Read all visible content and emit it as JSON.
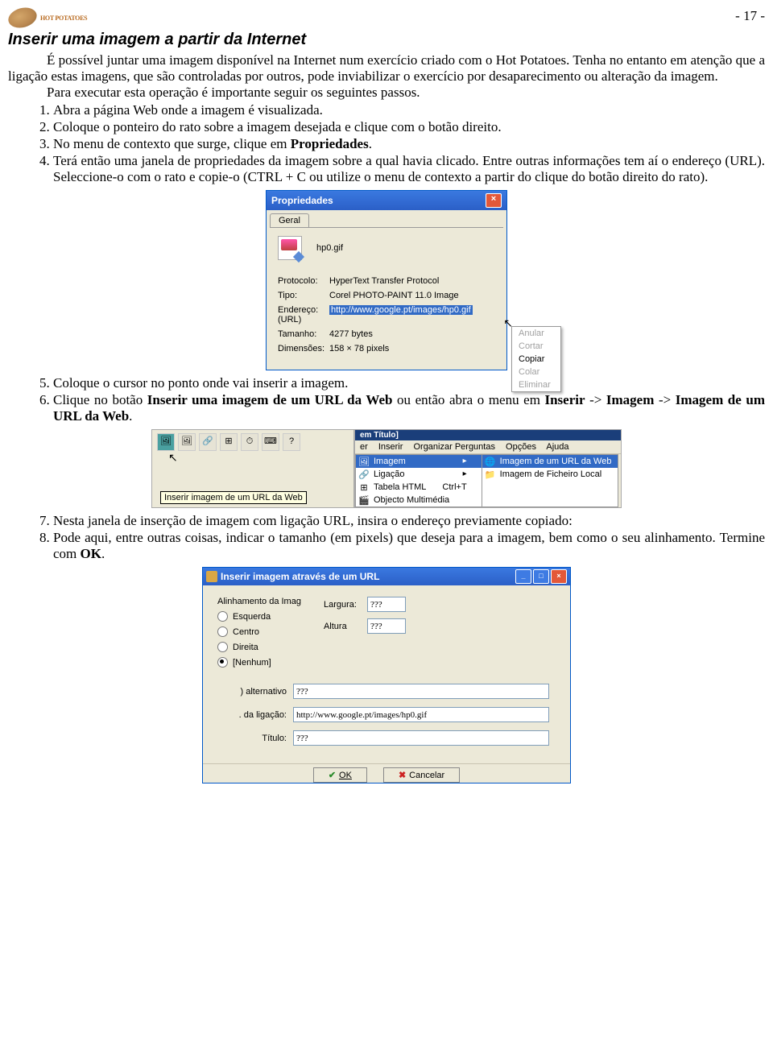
{
  "header": {
    "logo_text": "HOT POTATOES",
    "page_number": "- 17 -"
  },
  "title": "Inserir uma imagem a partir da Internet",
  "para1": "É possível juntar uma imagem disponível na Internet num exercício criado com o Hot Potatoes. Tenha no entanto em atenção que a ligação estas imagens, que são controladas por outros, pode inviabilizar o exercício por desaparecimento ou alteração da imagem.",
  "para2": "Para executar esta operação é importante seguir os seguintes passos.",
  "list1": {
    "s1": "Abra a página Web onde a imagem é visualizada.",
    "s2": "Coloque o ponteiro do rato sobre a imagem desejada e clique com o botão direito.",
    "s3a": "No menu de contexto que surge, clique em ",
    "s3b": "Propriedades",
    "s3c": ".",
    "s4": "Terá então uma janela de propriedades da imagem sobre a qual havia clicado. Entre outras informações tem aí o endereço (URL). Seleccione-o com o rato e copie-o (CTRL + C ou utilize o menu de contexto a partir do clique do botão direito do rato)."
  },
  "propdlg": {
    "title": "Propriedades",
    "tab": "Geral",
    "filename": "hp0.gif",
    "rows": {
      "proto_l": "Protocolo:",
      "proto_v": "HyperText Transfer Protocol",
      "tipo_l": "Tipo:",
      "tipo_v": "Corel PHOTO-PAINT 11.0 Image",
      "url_l": "Endereço:\n(URL)",
      "url_v": "http://www.google.pt/images/hp0.gif",
      "tam_l": "Tamanho:",
      "tam_v": "4277 bytes",
      "dim_l": "Dimensões:",
      "dim_v": "158 × 78 pixels"
    },
    "ctx": {
      "anular": "Anular",
      "cortar": "Cortar",
      "copiar": "Copiar",
      "colar": "Colar",
      "eliminar": "Eliminar"
    }
  },
  "list2": {
    "s5": "Coloque o cursor no ponto onde vai inserir a imagem.",
    "s6a": "Clique no botão ",
    "s6b": "Inserir uma imagem de um URL da Web",
    "s6c": " ou então abra o menu em ",
    "s6d": "Inserir",
    "s6e": " -> ",
    "s6f": "Imagem",
    "s6g": " -> ",
    "s6h": "Imagem de um URL da Web",
    "s6i": "."
  },
  "menu": {
    "titlestrip": "em Título]",
    "tooltip": "Inserir imagem de um URL da Web",
    "menubar": {
      "er": "er",
      "inserir": "Inserir",
      "organizar": "Organizar Perguntas",
      "opcoes": "Opções",
      "ajuda": "Ajuda"
    },
    "sub": {
      "imagem": "Imagem",
      "ligacao": "Ligação",
      "tabela": "Tabela HTML",
      "tabela_s": "Ctrl+T",
      "obj": "Objecto Multimédia"
    },
    "sub2": {
      "url": "Imagem de um URL da Web",
      "file": "Imagem de Ficheiro Local"
    }
  },
  "list3": {
    "s7": "Nesta janela de inserção de imagem com ligação URL, insira o endereço previamente copiado:",
    "s8a": "Pode aqui, entre outras coisas, indicar o tamanho (em pixels) que deseja para a imagem, bem como o seu alinhamento. Termine com ",
    "s8b": "OK",
    "s8c": "."
  },
  "dlg": {
    "title": "Inserir imagem através de um URL",
    "group": "Alinhamento da Imag",
    "esq": "Esquerda",
    "cen": "Centro",
    "dir": "Direita",
    "nen": "[Nenhum]",
    "largura_l": "Largura:",
    "altura_l": "Altura",
    "largura_v": "???",
    "altura_v": "???",
    "alt_l": ") alternativo",
    "alt_v": "???",
    "lig_l": ". da ligação:",
    "lig_v": "http://www.google.pt/images/hp0.gif",
    "tit_l": "Título:",
    "tit_v": "???",
    "ok": "OK",
    "cancel": "Cancelar"
  }
}
